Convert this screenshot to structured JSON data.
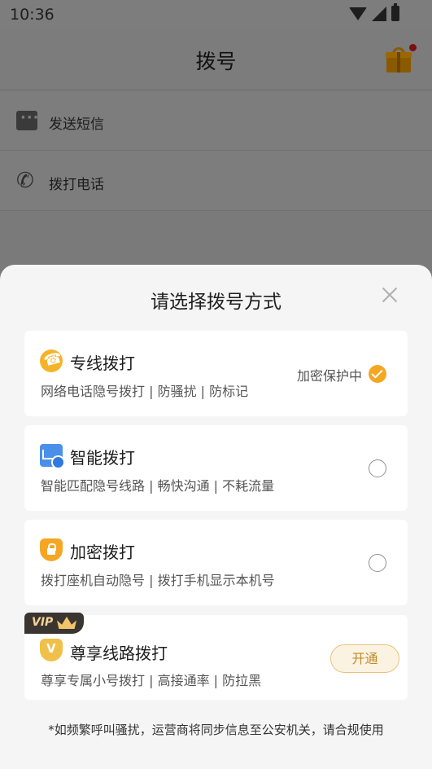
{
  "status_bar": {
    "time": "10:36"
  },
  "app_bar": {
    "title": "拨号"
  },
  "page_list": [
    {
      "label": "发送短信"
    },
    {
      "label": "拨打电话"
    }
  ],
  "sheet": {
    "title": "请选择拨号方式",
    "options": [
      {
        "name": "专线拨打",
        "desc": "网络电话隐号拨打 | 防骚扰 | 防标记",
        "status_label": "加密保护中",
        "selected": true
      },
      {
        "name": "智能拨打",
        "desc": "智能匹配隐号线路 | 畅快沟通 | 不耗流量",
        "selected": false
      },
      {
        "name": "加密拨打",
        "desc": "拨打座机自动隐号 | 拨打手机显示本机号",
        "selected": false
      },
      {
        "name": "尊享线路拨打",
        "desc": "尊享专属小号拨打 | 高接通率 | 防拉黑",
        "badge": "VIP",
        "action_label": "开通"
      }
    ],
    "footnote": "*如频繁呼叫骚扰，运营商将同步信息至公安机关，请合规使用"
  },
  "colors": {
    "accent": "#f5a623",
    "vip_dark": "#3a3530",
    "vip_gold": "#f4d59a"
  }
}
